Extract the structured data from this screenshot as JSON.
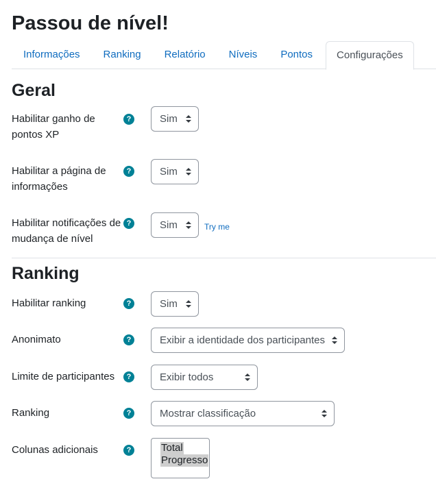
{
  "page": {
    "title": "Passou de nível!"
  },
  "tabs": [
    {
      "label": "Informações"
    },
    {
      "label": "Ranking"
    },
    {
      "label": "Relatório"
    },
    {
      "label": "Níveis"
    },
    {
      "label": "Pontos"
    },
    {
      "label": "Configurações",
      "active": true
    }
  ],
  "general": {
    "title": "Geral",
    "fields": [
      {
        "label": "Habilitar ganho de pontos XP",
        "value": "Sim"
      },
      {
        "label": "Habilitar a página de informações",
        "value": "Sim"
      },
      {
        "label": "Habilitar notificações de mudança de nível",
        "value": "Sim",
        "link": "Try me"
      }
    ]
  },
  "ranking": {
    "title": "Ranking",
    "fields": [
      {
        "label": "Habilitar ranking",
        "value": "Sim"
      },
      {
        "label": "Anonimato",
        "value": "Exibir a identidade dos participantes"
      },
      {
        "label": "Limite de participantes",
        "value": "Exibir todos"
      },
      {
        "label": "Ranking",
        "value": "Mostrar classificação"
      },
      {
        "label": "Colunas adicionais",
        "options": [
          "Total",
          "Progresso"
        ]
      }
    ]
  },
  "icons": {
    "help": "question-circle-icon",
    "select_caret": "sort-arrows-icon"
  },
  "colors": {
    "link": "#0f6cbf",
    "help_icon": "#008196",
    "text": "#1d2125"
  }
}
